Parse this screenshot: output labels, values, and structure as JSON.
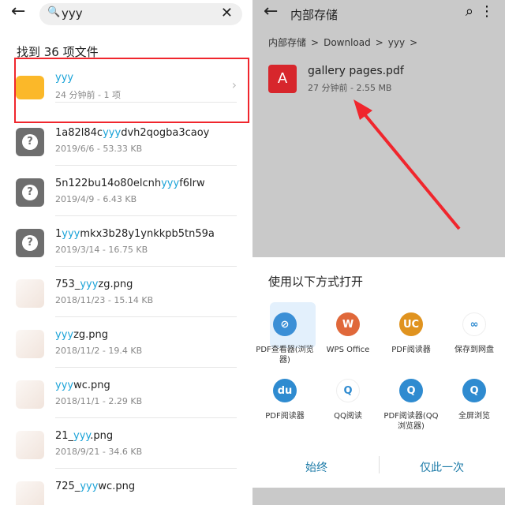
{
  "left": {
    "search_query": "yyy",
    "found_label": "找到 36 项文件",
    "items": [
      {
        "pre": "",
        "hl": "yyy",
        "post": "",
        "meta": "24 分钟前 - 1 项",
        "type": "folder"
      },
      {
        "pre": "1a82l84c",
        "hl": "yyy",
        "post": "dvh2qogba3caoy",
        "meta": "2019/6/6 - 53.33 KB",
        "type": "unknown"
      },
      {
        "pre": "5n122bu14o80elcnh",
        "hl": "yyy",
        "post": "f6lrw",
        "meta": "2019/4/9 - 6.43 KB",
        "type": "unknown"
      },
      {
        "pre": "1",
        "hl": "yyy",
        "post": "mkx3b28y1ynkkpb5tn59a",
        "meta": "2019/3/14 - 16.75 KB",
        "type": "unknown"
      },
      {
        "pre": "753_",
        "hl": "yyy",
        "post": "zg.png",
        "meta": "2018/11/23 - 15.14 KB",
        "type": "image"
      },
      {
        "pre": "",
        "hl": "yyy",
        "post": "zg.png",
        "meta": "2018/11/2 - 19.4 KB",
        "type": "image"
      },
      {
        "pre": "",
        "hl": "yyy",
        "post": "wc.png",
        "meta": "2018/11/1 - 2.29 KB",
        "type": "image"
      },
      {
        "pre": "21_",
        "hl": "yyy",
        "post": ".png",
        "meta": "2018/9/21 - 34.6 KB",
        "type": "image"
      },
      {
        "pre": "725_",
        "hl": "yyy",
        "post": "wc.png",
        "meta": "",
        "type": "image"
      }
    ]
  },
  "right": {
    "title": "内部存储",
    "breadcrumb": [
      "内部存储",
      ">",
      "Download",
      ">",
      "yyy",
      ">"
    ],
    "file": {
      "name": "gallery pages.pdf",
      "meta": "27 分钟前 - 2.55 MB"
    },
    "sheet": {
      "title": "使用以下方式打开",
      "apps": [
        {
          "label": "PDF查看器(浏览器)",
          "color": "#3b8fd6",
          "glyph": "⊘"
        },
        {
          "label": "WPS Office",
          "color": "#e0683a",
          "glyph": "W"
        },
        {
          "label": "PDF阅读器",
          "color": "#e0931f",
          "glyph": "UC"
        },
        {
          "label": "保存到网盘",
          "color": "#ffffff",
          "glyph": "∞"
        },
        {
          "label": "PDF阅读器",
          "color": "#2f8bd0",
          "glyph": "du"
        },
        {
          "label": "QQ阅读",
          "color": "#ffffff",
          "glyph": "Q"
        },
        {
          "label": "PDF阅读器(QQ浏览器)",
          "color": "#2f8bd0",
          "glyph": "Q"
        },
        {
          "label": "全屏浏览",
          "color": "#2f8bd0",
          "glyph": "Q"
        }
      ],
      "always": "始终",
      "once": "仅此一次"
    }
  },
  "colors": {
    "highlight": "#1aa3d8",
    "annotation": "#f0262d",
    "accent": "#1d7ba8"
  }
}
